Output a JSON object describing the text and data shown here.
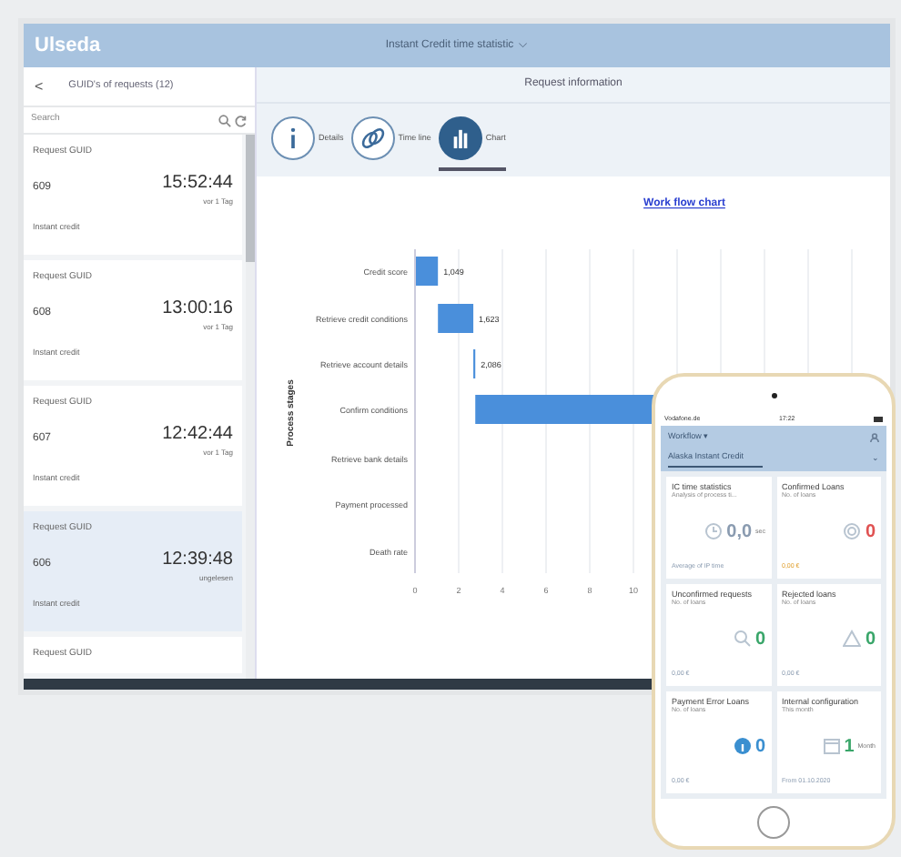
{
  "header": {
    "logo": "Ulseda",
    "title": "Instant Credit time statistic",
    "caret": "⌵"
  },
  "list_panel": {
    "back": "<",
    "title": "GUID's of requests (12)",
    "search": {
      "placeholder": "Search"
    },
    "items": [
      {
        "label": "Request GUID",
        "number": "609",
        "time": "15:52:44",
        "age": "vor 1 Tag",
        "type": "Instant credit",
        "selected": false
      },
      {
        "label": "Request GUID",
        "number": "608",
        "time": "13:00:16",
        "age": "vor 1 Tag",
        "type": "Instant credit",
        "selected": false
      },
      {
        "label": "Request GUID",
        "number": "607",
        "time": "12:42:44",
        "age": "vor 1 Tag",
        "type": "Instant credit",
        "selected": false
      },
      {
        "label": "Request GUID",
        "number": "606",
        "time": "12:39:48",
        "age": "ungelesen",
        "type": "Instant credit",
        "selected": true
      },
      {
        "label": "Request GUID",
        "selected": false
      }
    ]
  },
  "detail": {
    "title": "Request information",
    "tabs": [
      {
        "label": "Details",
        "kind": "info",
        "selected": false
      },
      {
        "label": "Time line",
        "kind": "link",
        "selected": false
      },
      {
        "label": "Chart",
        "kind": "chart",
        "selected": true
      }
    ],
    "chart": {
      "title": "Work flow chart",
      "ylabel": "Process stages",
      "categories": [
        "Credit score",
        "Retrieve credit conditions",
        "Retrieve account details",
        "Confirm conditions",
        "Retrieve bank details",
        "Payment processed",
        "Death rate"
      ],
      "value_labels": [
        "1,049",
        "1,623",
        "2,086"
      ],
      "xticks": [
        "0",
        "2",
        "4",
        "6",
        "8",
        "10"
      ]
    }
  },
  "phone": {
    "carrier": "Vodafone.de",
    "clock": "17:22",
    "menu": "Workflow ▾",
    "tab": "Alaska Instant Credit",
    "tab_caret": "⌄",
    "tiles": [
      {
        "title": "IC time statistics",
        "subtitle": "Analysis of process ti...",
        "kind": "clock",
        "value": "0,0",
        "unit": "sec",
        "color": "#8a9bb0",
        "footer": "Average of IP time",
        "footer_warning": false
      },
      {
        "title": "Confirmed Loans",
        "subtitle": "No. of loans",
        "kind": "coin",
        "value": "0",
        "color": "#e05252",
        "footer": "0,00 €",
        "footer_warning": true
      },
      {
        "title": "Unconfirmed requests",
        "subtitle": "No. of loans",
        "kind": "search",
        "value": "0",
        "color": "#3aa66a",
        "footer": "0,00 €",
        "footer_warning": false
      },
      {
        "title": "Rejected loans",
        "subtitle": "No. of loans",
        "kind": "warning",
        "value": "0",
        "color": "#3aa66a",
        "footer": "0,00 €",
        "footer_warning": false
      },
      {
        "title": "Payment Error Loans",
        "subtitle": "No. of loans",
        "kind": "info",
        "value": "0",
        "color": "#3a8fd0",
        "footer": "0,00 €",
        "footer_warning": false
      },
      {
        "title": "Internal configuration",
        "subtitle": "This month",
        "kind": "calendar",
        "value": "1",
        "unit": "Month",
        "color": "#3aa66a",
        "footer": "From 01.10.2020",
        "footer_warning": false
      }
    ]
  }
}
